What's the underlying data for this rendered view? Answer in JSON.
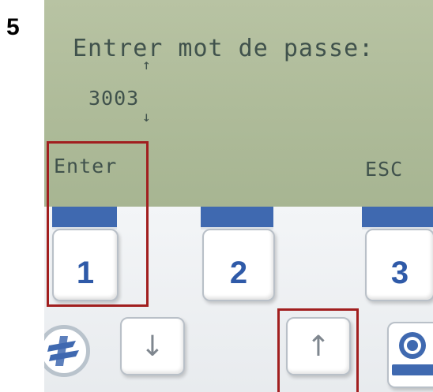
{
  "step": {
    "number": "5"
  },
  "lcd": {
    "prompt": "Entrer mot de passe:",
    "code": "3003",
    "up_arrow": "↑",
    "down_arrow": "↓",
    "left_softkey_label": "Enter",
    "right_softkey_label": "ESC"
  },
  "softkeys": [
    {
      "label": "1"
    },
    {
      "label": "2"
    },
    {
      "label": "3"
    }
  ],
  "arrow_keys": {
    "down": "↓",
    "up": "↑"
  },
  "colors": {
    "lcd_background": "#aebb99",
    "lcd_text": "#40524c",
    "key_blue": "#3f69b0",
    "highlight": "#a11f1f"
  },
  "icons": {
    "left_round_button": "logo-icon",
    "right_button": "power-icon"
  }
}
